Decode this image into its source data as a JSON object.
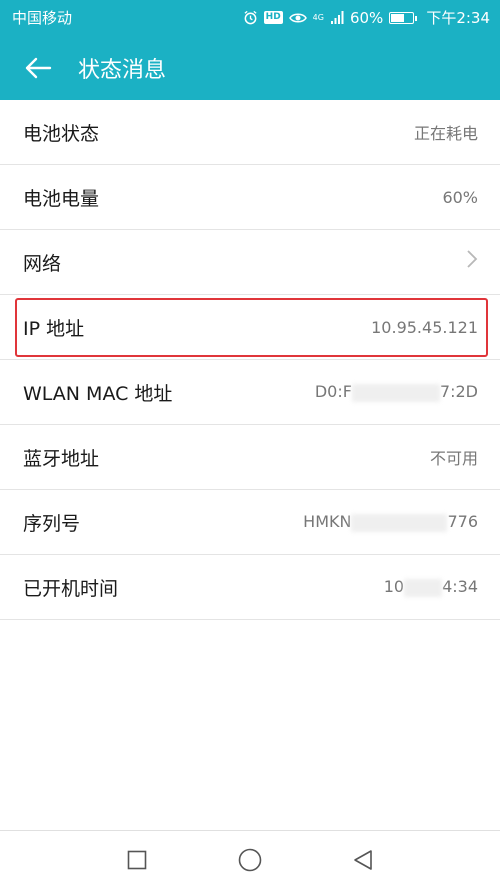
{
  "status_bar": {
    "carrier": "中国移动",
    "network_type": "4G",
    "battery_percent": "60%",
    "battery_level": 0.6,
    "time": "下午2:34",
    "hd_label": "HD"
  },
  "app_bar": {
    "title": "状态消息"
  },
  "rows": [
    {
      "label": "电池状态",
      "value": "正在耗电"
    },
    {
      "label": "电池电量",
      "value": "60%"
    },
    {
      "label": "网络",
      "value": ""
    },
    {
      "label": "IP 地址",
      "value": "10.95.45.121"
    },
    {
      "label": "WLAN MAC 地址",
      "value": "D0:F",
      "value_end": "7:2D"
    },
    {
      "label": "蓝牙地址",
      "value": "不可用"
    },
    {
      "label": "序列号",
      "value": "HMKN",
      "value_end": "776"
    },
    {
      "label": "已开机时间",
      "value": "10",
      "value_end": "4:34"
    }
  ],
  "colors": {
    "accent": "#1bb1c4",
    "highlight": "#e0353a"
  }
}
